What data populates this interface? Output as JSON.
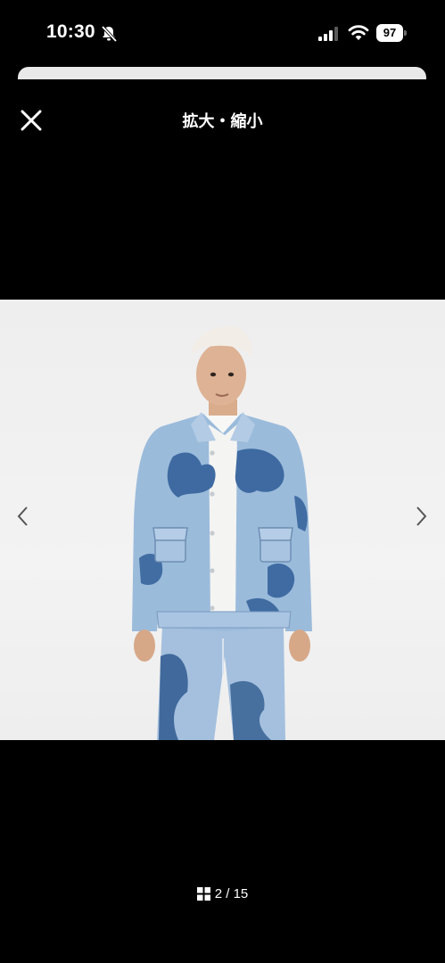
{
  "status_bar": {
    "time": "10:30",
    "battery_level": "97",
    "icons": [
      "bell-slash-icon",
      "cellular-signal-icon",
      "wifi-icon",
      "battery-icon"
    ]
  },
  "header": {
    "title": "拡大・縮小",
    "close_icon": "close-icon"
  },
  "gallery": {
    "prev_icon": "chevron-left-icon",
    "next_icon": "chevron-right-icon",
    "current": "2",
    "total": "15",
    "counter_text": "2 / 15",
    "grid_icon": "grid-icon"
  },
  "colors": {
    "background": "#000000",
    "image_backdrop": "#efefef",
    "denim_light": "#9ab9d9",
    "denim_dark": "#3f6a9f"
  }
}
